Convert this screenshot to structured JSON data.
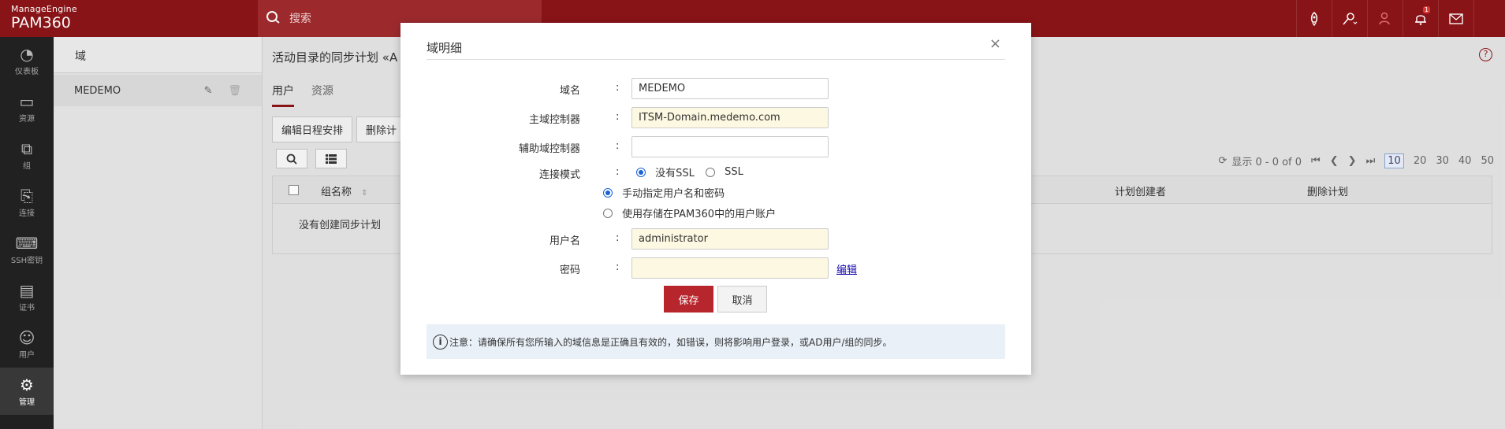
{
  "header": {
    "brand_top": "ManageEngine",
    "brand_name": "PAM360",
    "search_placeholder": "搜索",
    "notification_count": "1"
  },
  "leftnav": [
    {
      "label": "仪表板",
      "icon": "dashboard-icon",
      "glyph": "◔"
    },
    {
      "label": "资源",
      "icon": "monitor-icon",
      "glyph": "▭"
    },
    {
      "label": "组",
      "icon": "group-icon",
      "glyph": "⧉"
    },
    {
      "label": "连接",
      "icon": "connection-icon",
      "glyph": "⎘"
    },
    {
      "label": "SSH密钥",
      "icon": "ssh-key-icon",
      "glyph": "⌨"
    },
    {
      "label": "证书",
      "icon": "certificate-icon",
      "glyph": "▤"
    },
    {
      "label": "用户",
      "icon": "user-icon",
      "glyph": "☺"
    },
    {
      "label": "管理",
      "icon": "gear-icon",
      "glyph": "⚙"
    }
  ],
  "domain_panel": {
    "title": "域",
    "items": [
      {
        "name": "MEDEMO"
      }
    ]
  },
  "main": {
    "title": "活动目录的同步计划 «A",
    "tabs": [
      {
        "label": "用户"
      },
      {
        "label": "资源"
      }
    ],
    "buttons": {
      "edit_schedule": "编辑日程安排",
      "delete": "删除计"
    },
    "pager": {
      "summary": "显示 0 - 0 of 0",
      "sizes": [
        "10",
        "20",
        "30",
        "40",
        "50"
      ]
    },
    "columns": {
      "group_name": "组名称",
      "creator": "计划创建者",
      "delete_plan": "删除计划"
    },
    "empty_text": "没有创建同步计划"
  },
  "modal": {
    "title": "域明细",
    "labels": {
      "domain": "域名",
      "primary_dc": "主域控制器",
      "secondary_dc": "辅助域控制器",
      "conn_mode": "连接模式",
      "username": "用户名",
      "password": "密码"
    },
    "values": {
      "domain": "MEDEMO",
      "primary_dc": "ITSM-Domain.medemo.com",
      "secondary_dc": "",
      "username": "administrator",
      "password": ""
    },
    "conn_options": {
      "no_ssl": "没有SSL",
      "ssl": "SSL"
    },
    "cred_options": {
      "manual": "手动指定用户名和密码",
      "stored": "使用存储在PAM360中的用户账户"
    },
    "edit_link": "编辑",
    "save": "保存",
    "cancel": "取消",
    "note": "注意：请确保所有您所输入的域信息是正确且有效的，如错误，则将影响用户登录，或AD用户/组的同步。"
  },
  "colors": {
    "brand": "#8c1518",
    "save": "#b7262c",
    "link": "#1a0dab"
  }
}
